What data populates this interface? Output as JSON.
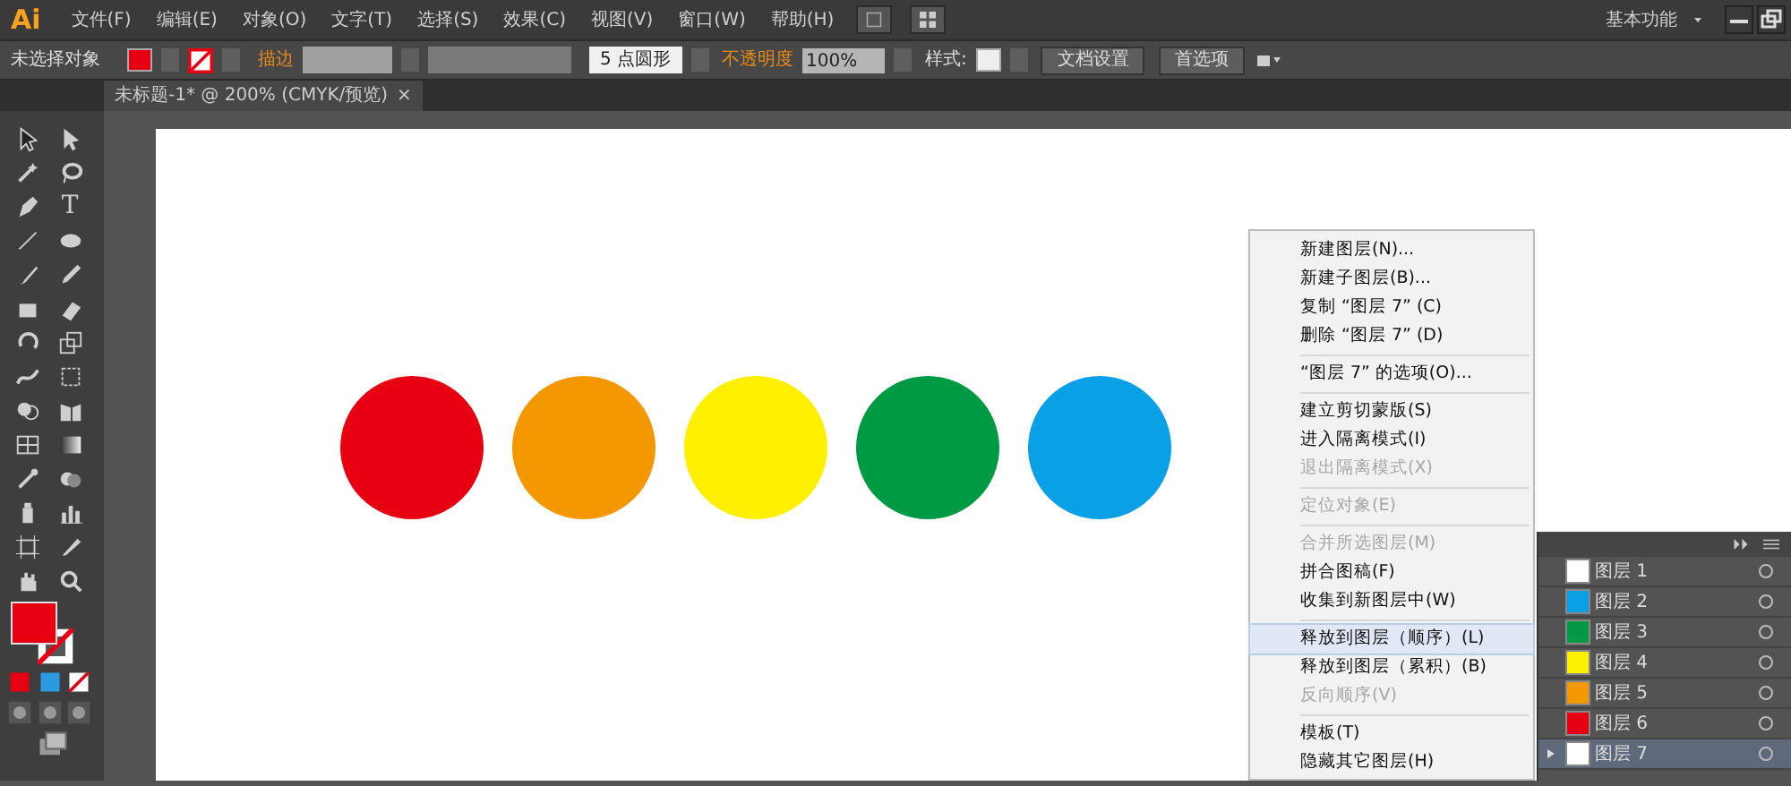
{
  "app": {
    "logo": "Ai",
    "workspace": "基本功能"
  },
  "menus": [
    "文件(F)",
    "编辑(E)",
    "对象(O)",
    "文字(T)",
    "选择(S)",
    "效果(C)",
    "视图(V)",
    "窗口(W)",
    "帮助(H)"
  ],
  "control_bar": {
    "selection": "未选择对象",
    "stroke_label": "描边",
    "brush": "5 点圆形",
    "opacity_label": "不透明度",
    "opacity": "100%",
    "style_label": "样式:",
    "buttons": [
      "文档设置",
      "首选项"
    ]
  },
  "tabs": [
    {
      "label": "未标题-1* @ 200% (CMYK/预览)",
      "close": "×",
      "selected": true
    }
  ],
  "tools": {
    "type_label": "T"
  },
  "shapes": [
    {
      "kind": "circle",
      "color": "#e60012"
    },
    {
      "kind": "circle",
      "color": "#f39800"
    },
    {
      "kind": "circle",
      "color": "#fff000"
    },
    {
      "kind": "circle",
      "color": "#009944"
    },
    {
      "kind": "circle",
      "color": "#0aa0e6"
    }
  ],
  "context_menu": {
    "items": [
      {
        "kind": "item",
        "label": "新建图层(N)...",
        "disabled": false,
        "selected": false
      },
      {
        "kind": "item",
        "label": "新建子图层(B)...",
        "disabled": false,
        "selected": false
      },
      {
        "kind": "item",
        "label": "复制 “图层 7” (C)",
        "disabled": false,
        "selected": false
      },
      {
        "kind": "item",
        "label": "删除 “图层 7” (D)",
        "disabled": false,
        "selected": false
      },
      {
        "kind": "separator"
      },
      {
        "kind": "item",
        "label": "“图层 7” 的选项(O)...",
        "disabled": false,
        "selected": false
      },
      {
        "kind": "separator"
      },
      {
        "kind": "item",
        "label": "建立剪切蒙版(S)",
        "disabled": false,
        "selected": false
      },
      {
        "kind": "item",
        "label": "进入隔离模式(I)",
        "disabled": false,
        "selected": false
      },
      {
        "kind": "item",
        "label": "退出隔离模式(X)",
        "disabled": true,
        "selected": false
      },
      {
        "kind": "separator"
      },
      {
        "kind": "item",
        "label": "定位对象(E)",
        "disabled": true,
        "selected": false
      },
      {
        "kind": "separator"
      },
      {
        "kind": "item",
        "label": "合并所选图层(M)",
        "disabled": true,
        "selected": false
      },
      {
        "kind": "item",
        "label": "拼合图稿(F)",
        "disabled": false,
        "selected": false
      },
      {
        "kind": "item",
        "label": "收集到新图层中(W)",
        "disabled": false,
        "selected": false
      },
      {
        "kind": "separator"
      },
      {
        "kind": "item",
        "label": "释放到图层（顺序）(L)",
        "disabled": false,
        "selected": true
      },
      {
        "kind": "item",
        "label": "释放到图层（累积）(B)",
        "disabled": false,
        "selected": false
      },
      {
        "kind": "item",
        "label": "反向顺序(V)",
        "disabled": true,
        "selected": false
      },
      {
        "kind": "separator"
      },
      {
        "kind": "item",
        "label": "模板(T)",
        "disabled": false,
        "selected": false
      },
      {
        "kind": "item",
        "label": "隐藏其它图层(H)",
        "disabled": false,
        "selected": false
      }
    ]
  },
  "layers": [
    {
      "name": "图层 1",
      "color": "#ffffff",
      "selected": false,
      "expandable": false
    },
    {
      "name": "图层 2",
      "color": "#0aa0e6",
      "selected": false,
      "expandable": false
    },
    {
      "name": "图层 3",
      "color": "#009944",
      "selected": false,
      "expandable": false
    },
    {
      "name": "图层 4",
      "color": "#fff000",
      "selected": false,
      "expandable": false
    },
    {
      "name": "图层 5",
      "color": "#f39800",
      "selected": false,
      "expandable": false
    },
    {
      "name": "图层 6",
      "color": "#e60012",
      "selected": false,
      "expandable": false
    },
    {
      "name": "图层 7",
      "color": "#ffffff",
      "selected": true,
      "expandable": true
    }
  ]
}
